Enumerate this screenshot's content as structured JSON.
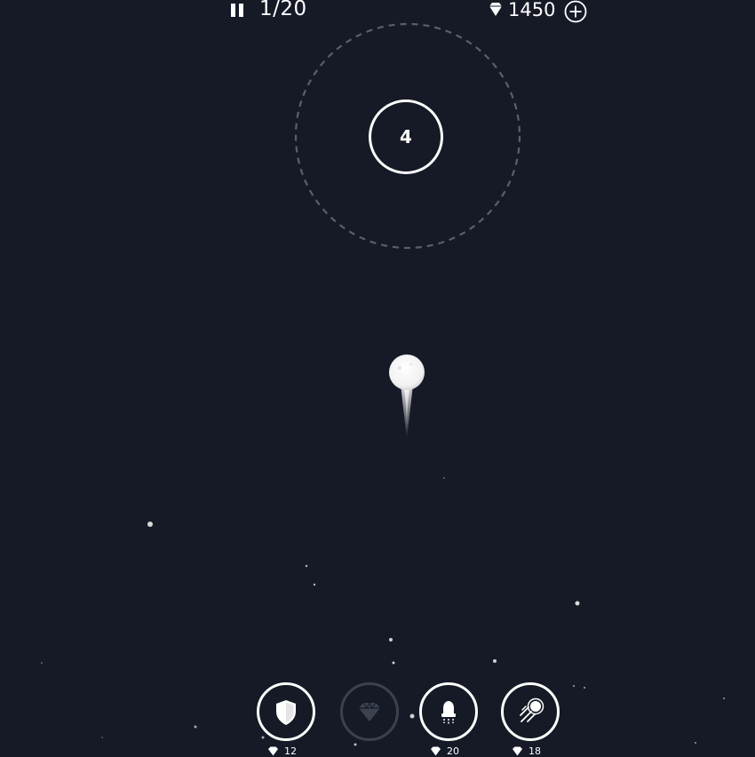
{
  "hud": {
    "level_progress": "1/20",
    "gem_count": "1450"
  },
  "target": {
    "hits_remaining": "4"
  },
  "powerups": [
    {
      "name": "shield",
      "price": "12",
      "enabled": true
    },
    {
      "name": "gem",
      "price": "",
      "enabled": false
    },
    {
      "name": "rocket",
      "price": "20",
      "enabled": true
    },
    {
      "name": "meteor",
      "price": "18",
      "enabled": true
    }
  ],
  "colors": {
    "background": "#161a27",
    "foreground": "#ffffff",
    "disabled": "#3c4150",
    "orbit": "#5a5f6c"
  }
}
